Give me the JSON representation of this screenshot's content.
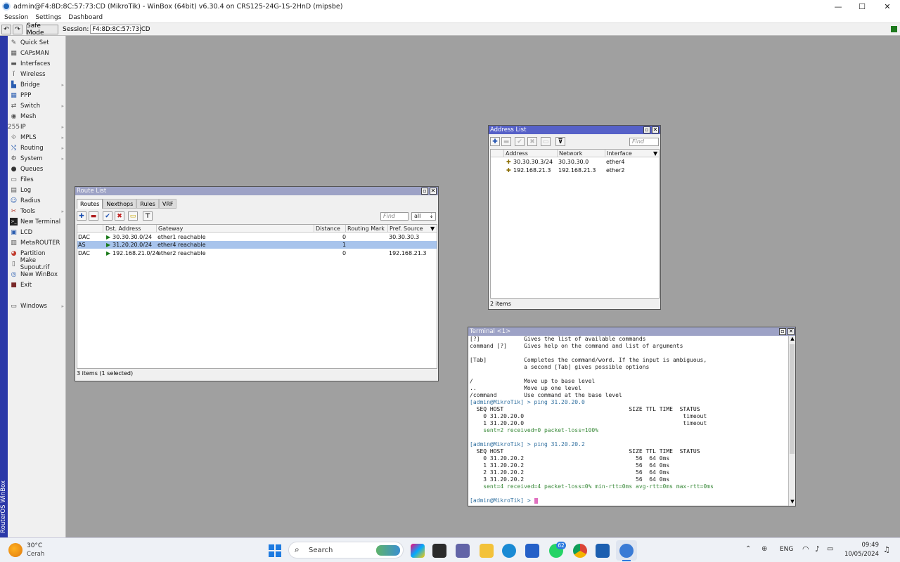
{
  "window": {
    "title": "admin@F4:8D:8C:57:73:CD (MikroTik) - WinBox (64bit) v6.30.4 on CRS125-24G-1S-2HnD (mipsbe)",
    "minimize": "—",
    "maximize": "☐",
    "close": "✕"
  },
  "menubar": {
    "items": [
      "Session",
      "Settings",
      "Dashboard"
    ]
  },
  "toolbar": {
    "undo": "↶",
    "redo": "↷",
    "safe_mode": "Safe Mode",
    "session_label": "Session:",
    "session_value": "F4:8D:8C:57:73:CD"
  },
  "sidestrip": {
    "label": "RouterOS WinBox"
  },
  "sidemenu": {
    "items": [
      {
        "label": "Quick Set",
        "icon": "quick-set-icon"
      },
      {
        "label": "CAPsMAN",
        "icon": "capsman-icon"
      },
      {
        "label": "Interfaces",
        "icon": "interfaces-icon"
      },
      {
        "label": "Wireless",
        "icon": "wireless-icon"
      },
      {
        "label": "Bridge",
        "icon": "bridge-icon"
      },
      {
        "label": "PPP",
        "icon": "ppp-icon"
      },
      {
        "label": "Switch",
        "icon": "switch-icon"
      },
      {
        "label": "Mesh",
        "icon": "mesh-icon"
      },
      {
        "label": "IP",
        "icon": "ip-icon"
      },
      {
        "label": "MPLS",
        "icon": "mpls-icon"
      },
      {
        "label": "Routing",
        "icon": "routing-icon"
      },
      {
        "label": "System",
        "icon": "system-icon"
      },
      {
        "label": "Queues",
        "icon": "queues-icon"
      },
      {
        "label": "Files",
        "icon": "files-icon"
      },
      {
        "label": "Log",
        "icon": "log-icon"
      },
      {
        "label": "Radius",
        "icon": "radius-icon"
      },
      {
        "label": "Tools",
        "icon": "tools-icon"
      },
      {
        "label": "New Terminal",
        "icon": "terminal-icon"
      },
      {
        "label": "LCD",
        "icon": "lcd-icon"
      },
      {
        "label": "MetaROUTER",
        "icon": "metarouter-icon"
      },
      {
        "label": "Partition",
        "icon": "partition-icon"
      },
      {
        "label": "Make Supout.rif",
        "icon": "supout-icon"
      },
      {
        "label": "New WinBox",
        "icon": "winbox-icon"
      },
      {
        "label": "Exit",
        "icon": "exit-icon"
      },
      {
        "label": "Windows",
        "icon": "windows-icon"
      }
    ]
  },
  "route_list": {
    "title": "Route List",
    "tabs": [
      "Routes",
      "Nexthops",
      "Rules",
      "VRF"
    ],
    "find_placeholder": "Find",
    "filter_value": "all",
    "columns": [
      "",
      "Dst. Address",
      "Gateway",
      "Distance",
      "Routing Mark",
      "Pref. Source"
    ],
    "rows": [
      {
        "flags": "DAC",
        "dst": "30.30.30.0/24",
        "gateway": "ether1 reachable",
        "distance": "0",
        "routing_mark": "",
        "pref_source": "30.30.30.3",
        "selected": false
      },
      {
        "flags": "AS",
        "dst": "31.20.20.0/24",
        "gateway": "ether4 reachable",
        "distance": "1",
        "routing_mark": "",
        "pref_source": "",
        "selected": true
      },
      {
        "flags": "DAC",
        "dst": "192.168.21.0/24",
        "gateway": "ether2 reachable",
        "distance": "0",
        "routing_mark": "",
        "pref_source": "192.168.21.3",
        "selected": false
      }
    ],
    "status": "3 items (1 selected)"
  },
  "address_list": {
    "title": "Address List",
    "find_placeholder": "Find",
    "columns": [
      "Address",
      "Network",
      "Interface"
    ],
    "rows": [
      {
        "address": "30.30.30.3/24",
        "network": "30.30.30.0",
        "interface": "ether4"
      },
      {
        "address": "192.168.21.3",
        "network": "192.168.21.3",
        "interface": "ether2"
      }
    ],
    "status": "2 items"
  },
  "terminal": {
    "title": "Terminal <1>",
    "lines": [
      {
        "text": "[?]             Gives the list of available commands",
        "color": "#222"
      },
      {
        "text": "command [?]     Gives help on the command and list of arguments",
        "color": "#222"
      },
      {
        "text": "",
        "color": "#222"
      },
      {
        "text": "[Tab]           Completes the command/word. If the input is ambiguous,",
        "color": "#222"
      },
      {
        "text": "                a second [Tab] gives possible options",
        "color": "#222"
      },
      {
        "text": "",
        "color": "#222"
      },
      {
        "text": "/               Move up to base level",
        "color": "#222"
      },
      {
        "text": "..              Move up one level",
        "color": "#222"
      },
      {
        "text": "/command        Use command at the base level",
        "color": "#222"
      },
      {
        "text": "[admin@MikroTik] > ping 31.20.20.0",
        "color": "#2f6f9f"
      },
      {
        "text": "  SEQ HOST                                     SIZE TTL TIME  STATUS",
        "color": "#111"
      },
      {
        "text": "    0 31.20.20.0                                               timeout",
        "color": "#222"
      },
      {
        "text": "    1 31.20.20.0                                               timeout",
        "color": "#222"
      },
      {
        "text": "    sent=2 received=0 packet-loss=100%",
        "color": "#3a8a3a"
      },
      {
        "text": "",
        "color": "#222"
      },
      {
        "text": "[admin@MikroTik] > ping 31.20.20.2",
        "color": "#2f6f9f"
      },
      {
        "text": "  SEQ HOST                                     SIZE TTL TIME  STATUS",
        "color": "#111"
      },
      {
        "text": "    0 31.20.20.2                                 56  64 0ms",
        "color": "#222"
      },
      {
        "text": "    1 31.20.20.2                                 56  64 0ms",
        "color": "#222"
      },
      {
        "text": "    2 31.20.20.2                                 56  64 0ms",
        "color": "#222"
      },
      {
        "text": "    3 31.20.20.2                                 56  64 0ms",
        "color": "#222"
      },
      {
        "text": "    sent=4 received=4 packet-loss=0% min-rtt=0ms avg-rtt=0ms max-rtt=0ms",
        "color": "#3a8a3a"
      },
      {
        "text": "",
        "color": "#222"
      },
      {
        "text": "[admin@MikroTik] > ",
        "color": "#2f6f9f"
      }
    ]
  },
  "taskbar": {
    "weather_temp": "30°C",
    "weather_desc": "Cerah",
    "search_placeholder": "Search",
    "whatsapp_badge": "62",
    "language": "ENG",
    "time": "09:49",
    "date": "10/05/2024"
  }
}
